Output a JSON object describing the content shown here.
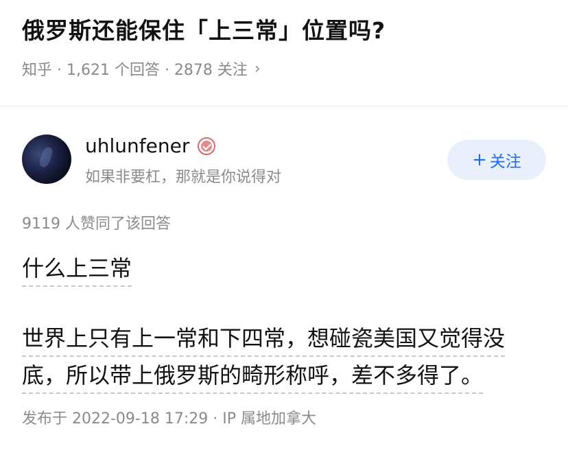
{
  "question": {
    "title": "俄罗斯还能保住「上三常」位置吗?",
    "meta": "知乎 · 1,621 个回答 · 2878 关注",
    "chevron": "›"
  },
  "author": {
    "name": "uhlunfener",
    "bio": "如果非要杠，那就是你说得对",
    "follow_label": "关注",
    "follow_icon": "+",
    "badge_icon": "verified-badge"
  },
  "answer": {
    "upvotes": "9119 人赞同了该回答",
    "paragraph1": "什么上三常",
    "paragraph2_line1": "世界上只有上一常和下四常，想碰瓷美国又觉得没",
    "paragraph2_line2": "底，所以带上俄罗斯的畸形称呼，差不多得了。",
    "published": "发布于 2022-09-18 17:29 · IP 属地加拿大"
  },
  "colors": {
    "accent": "#1a6cff",
    "follow_bg": "#e9f0fc",
    "muted": "#8a8a8a",
    "badge": "#d96868"
  }
}
